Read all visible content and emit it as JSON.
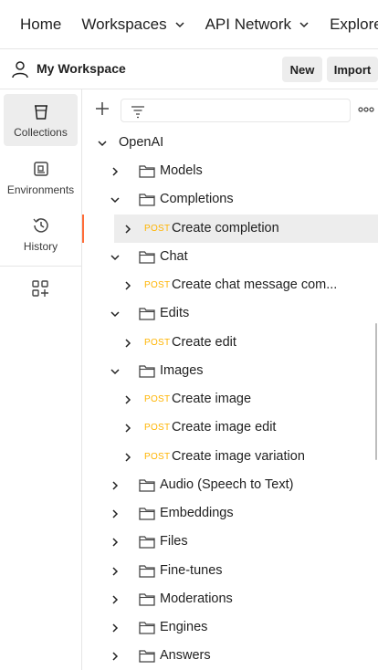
{
  "topnav": {
    "items": [
      {
        "label": "Home",
        "has_dropdown": false
      },
      {
        "label": "Workspaces",
        "has_dropdown": true
      },
      {
        "label": "API Network",
        "has_dropdown": true
      },
      {
        "label": "Explore",
        "has_dropdown": false
      }
    ]
  },
  "workspace": {
    "title": "My Workspace",
    "new_label": "New",
    "import_label": "Import"
  },
  "sidebar": {
    "items": [
      {
        "label": "Collections",
        "icon": "trash-can-icon",
        "active": true
      },
      {
        "label": "Environments",
        "icon": "environment-icon",
        "active": false
      },
      {
        "label": "History",
        "icon": "history-icon",
        "active": false
      }
    ],
    "add_icon": "add-workspace-icon"
  },
  "tree": {
    "collection": "OpenAI",
    "rows": [
      {
        "type": "folder",
        "label": "Models",
        "expanded": false
      },
      {
        "type": "folder",
        "label": "Completions",
        "expanded": true
      },
      {
        "type": "request",
        "method": "POST",
        "label": "Create completion",
        "selected": true
      },
      {
        "type": "folder",
        "label": "Chat",
        "expanded": true
      },
      {
        "type": "request",
        "method": "POST",
        "label": "Create chat message com..."
      },
      {
        "type": "folder",
        "label": "Edits",
        "expanded": true
      },
      {
        "type": "request",
        "method": "POST",
        "label": "Create edit"
      },
      {
        "type": "folder",
        "label": "Images",
        "expanded": true
      },
      {
        "type": "request",
        "method": "POST",
        "label": "Create image"
      },
      {
        "type": "request",
        "method": "POST",
        "label": "Create image edit"
      },
      {
        "type": "request",
        "method": "POST",
        "label": "Create image variation"
      },
      {
        "type": "folder",
        "label": "Audio (Speech to Text)",
        "expanded": false
      },
      {
        "type": "folder",
        "label": "Embeddings",
        "expanded": false
      },
      {
        "type": "folder",
        "label": "Files",
        "expanded": false
      },
      {
        "type": "folder",
        "label": "Fine-tunes",
        "expanded": false
      },
      {
        "type": "folder",
        "label": "Moderations",
        "expanded": false
      },
      {
        "type": "folder",
        "label": "Engines",
        "expanded": false
      },
      {
        "type": "folder",
        "label": "Answers",
        "expanded": false
      }
    ]
  },
  "colors": {
    "accent": "#ff6c37",
    "post": "#ffb400",
    "selected_bg": "#ededed"
  }
}
